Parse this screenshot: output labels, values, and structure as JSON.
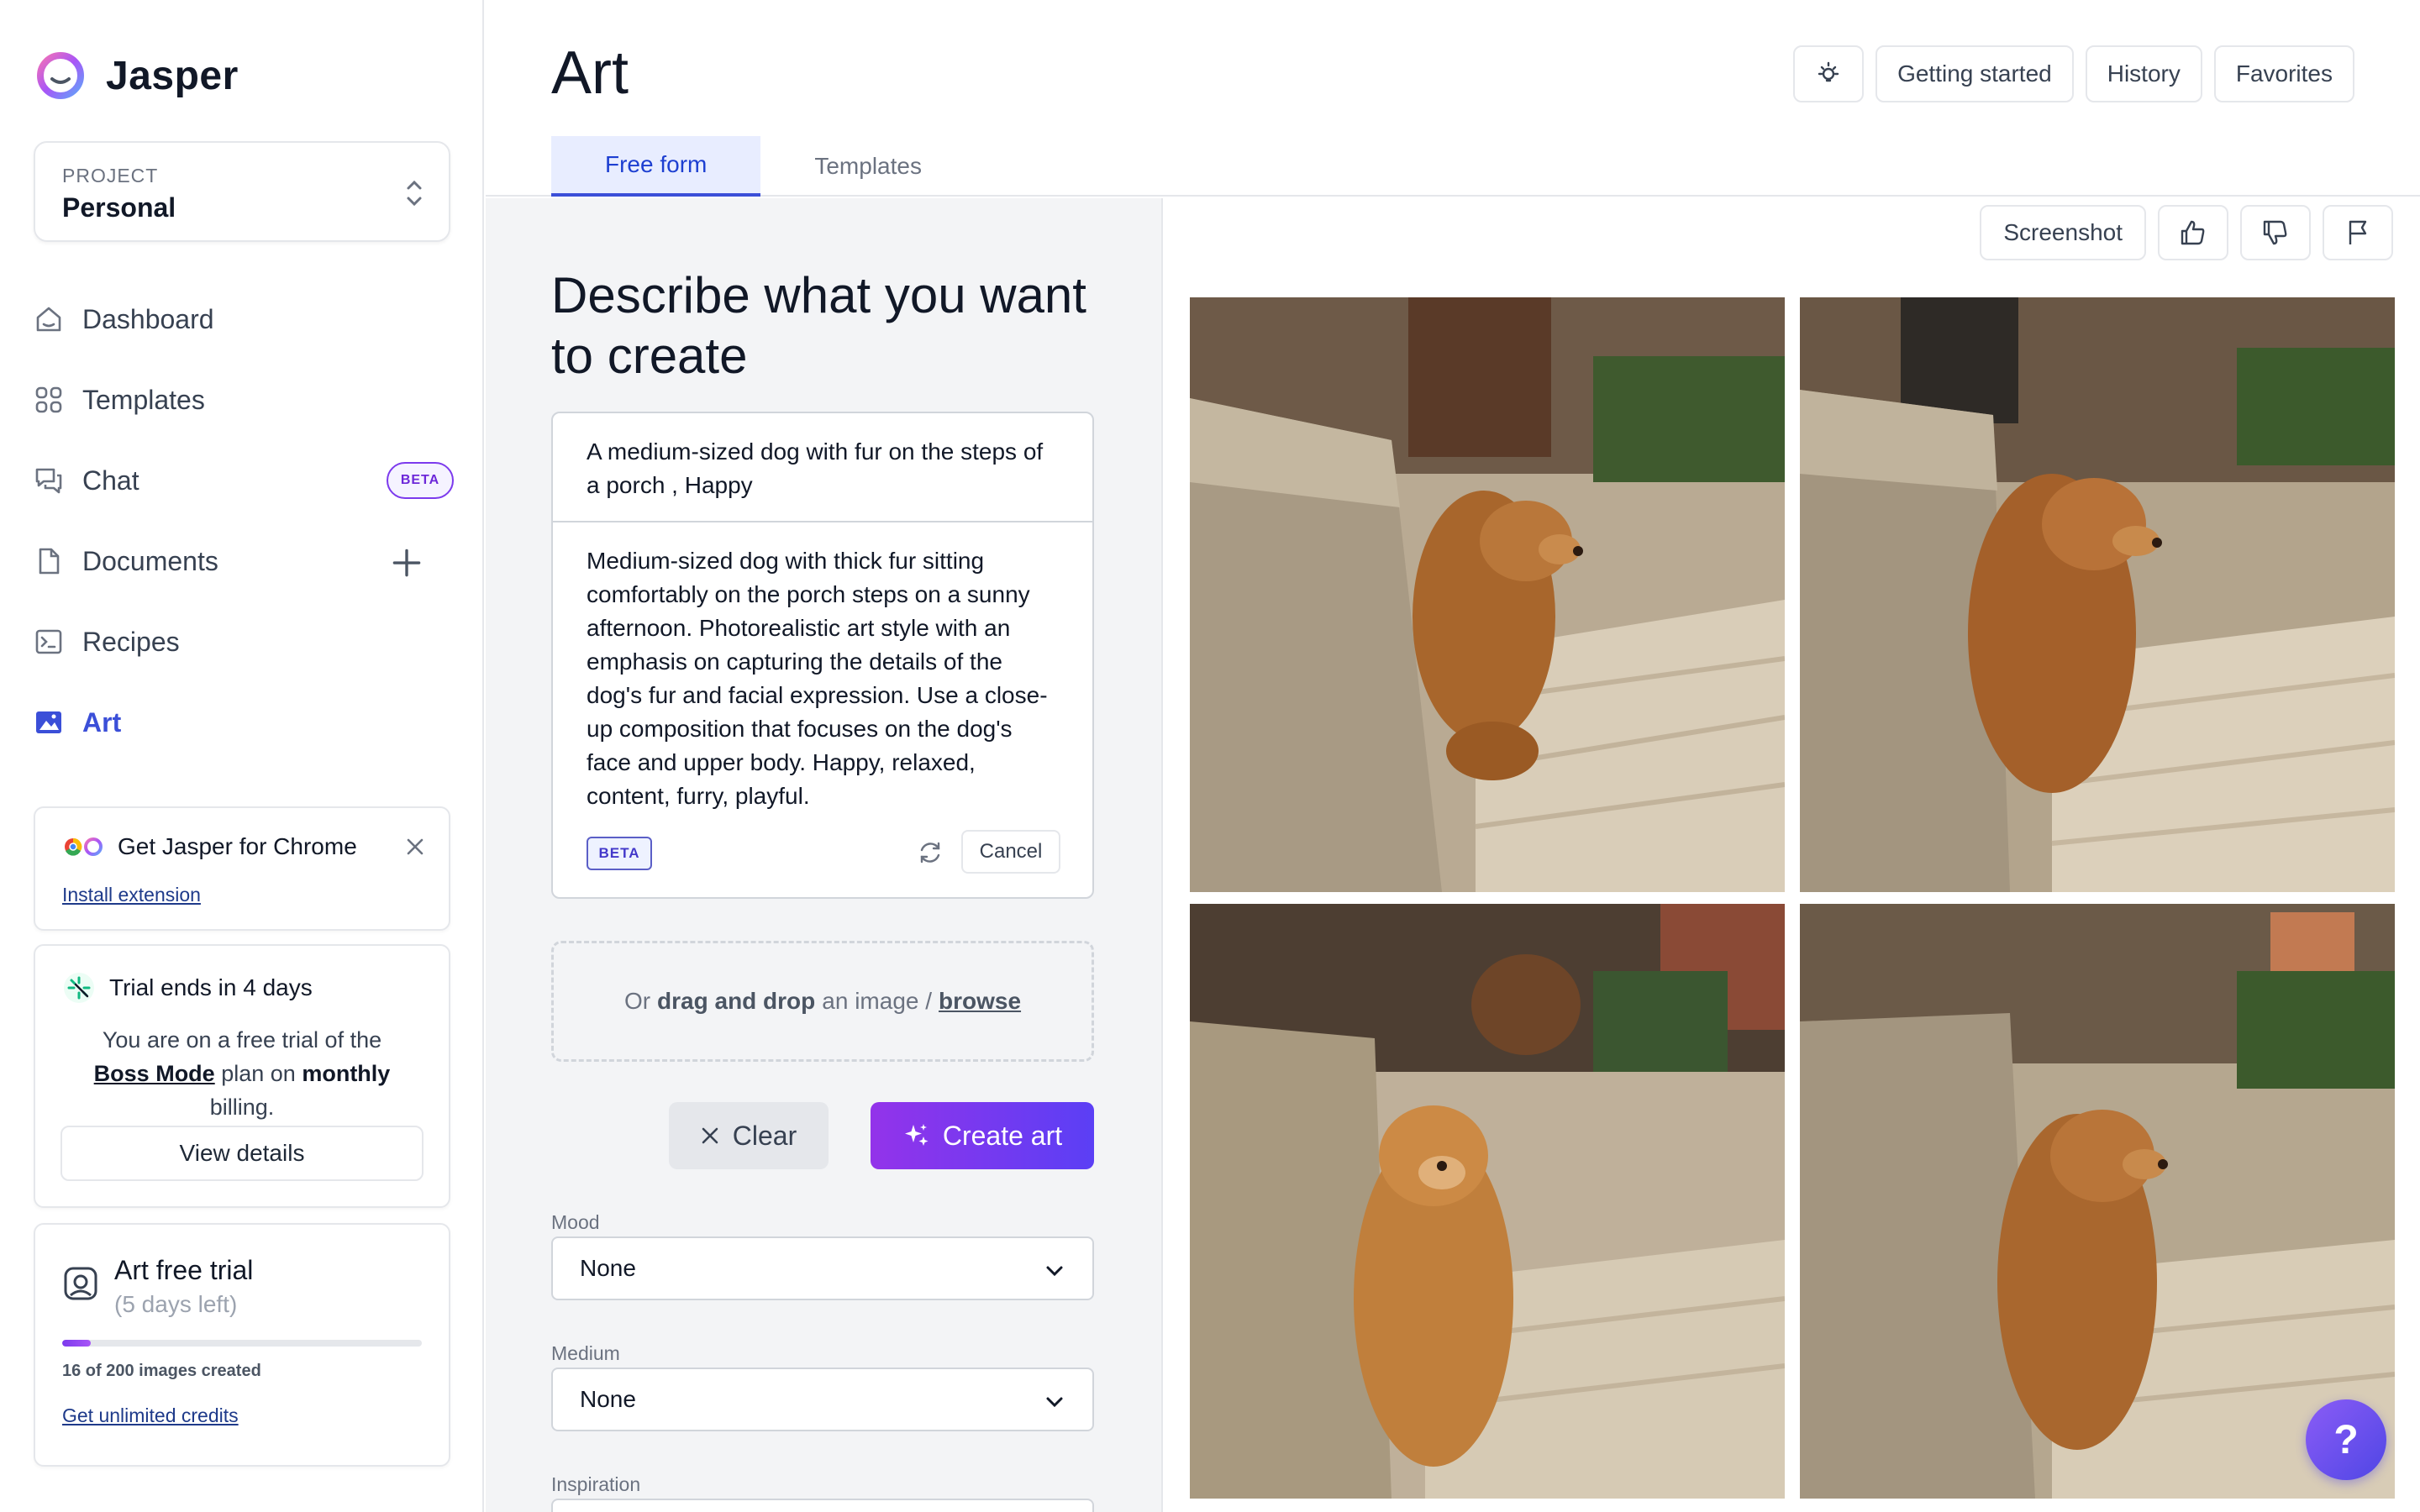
{
  "app": {
    "name": "Jasper"
  },
  "project": {
    "label": "PROJECT",
    "value": "Personal"
  },
  "nav": [
    {
      "label": "Dashboard",
      "icon": "home-icon"
    },
    {
      "label": "Templates",
      "icon": "grid-icon"
    },
    {
      "label": "Chat",
      "icon": "chat-icon",
      "badge": "BETA"
    },
    {
      "label": "Documents",
      "icon": "document-icon"
    },
    {
      "label": "Recipes",
      "icon": "terminal-icon"
    },
    {
      "label": "Art",
      "icon": "image-icon",
      "active": true
    }
  ],
  "chrome_promo": {
    "title": "Get Jasper for Chrome",
    "link": "Install extension"
  },
  "trial": {
    "title": "Trial ends in 4 days",
    "line1": "You are on a free trial of the",
    "plan": "Boss Mode",
    "mid": "plan on",
    "period": "monthly",
    "line3": "billing.",
    "button": "View details"
  },
  "art_trial": {
    "title": "Art free trial",
    "subtitle": "(5 days left)",
    "progress_fraction": 0.08,
    "count_text": "16 of 200 images created",
    "link": "Get unlimited credits"
  },
  "header": {
    "title": "Art",
    "tabs": [
      "Free form",
      "Templates"
    ],
    "buttons": [
      "Getting started",
      "History",
      "Favorites"
    ]
  },
  "form": {
    "heading": "Describe what you want to create",
    "prompt_short": "A medium-sized dog with fur on the steps of a porch , Happy",
    "prompt_long": "Medium-sized dog with thick fur sitting comfortably on the porch steps on a sunny afternoon. Photorealistic art style with an emphasis on capturing the details of the dog's fur and facial expression. Use a close-up composition that focuses on the dog's face and upper body. Happy, relaxed, content, furry, playful.",
    "beta": "BETA",
    "cancel": "Cancel",
    "dropzone": {
      "prefix": "Or",
      "bold": "drag and drop",
      "middle": "an image /",
      "link": "browse"
    },
    "clear": "Clear",
    "create": "Create art",
    "fields": [
      {
        "label": "Mood",
        "value": "None"
      },
      {
        "label": "Medium",
        "value": "None"
      },
      {
        "label": "Inspiration",
        "value": ""
      }
    ]
  },
  "images_toolbar": {
    "screenshot": "Screenshot"
  },
  "help": "?"
}
